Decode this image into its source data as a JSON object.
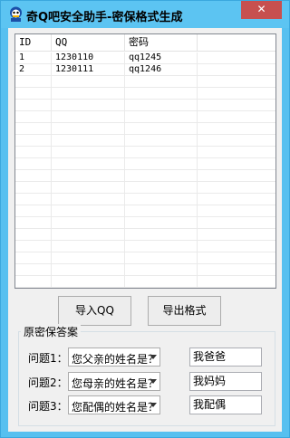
{
  "window": {
    "title": "奇Q吧安全助手-密保格式生成",
    "close_glyph": "✕"
  },
  "list": {
    "headers": [
      "ID",
      "QQ",
      "密码"
    ],
    "rows": [
      [
        "1",
        "1230110",
        "qq1245"
      ],
      [
        "2",
        "1230111",
        "qq1246"
      ]
    ]
  },
  "buttons": {
    "import_qq": "导入QQ",
    "export_format": "导出格式"
  },
  "security": {
    "group_title": "原密保答案",
    "questions": [
      {
        "label": "问题1：",
        "selected": "您父亲的姓名是？",
        "answer": "我爸爸"
      },
      {
        "label": "问题2：",
        "selected": "您母亲的姓名是？",
        "answer": "我妈妈"
      },
      {
        "label": "问题3：",
        "selected": "您配偶的姓名是？",
        "answer": "我配偶"
      }
    ]
  },
  "colors": {
    "title_bar": "#5cc4f2",
    "close_button": "#c7504f",
    "client_bg": "#f0f0f0"
  }
}
